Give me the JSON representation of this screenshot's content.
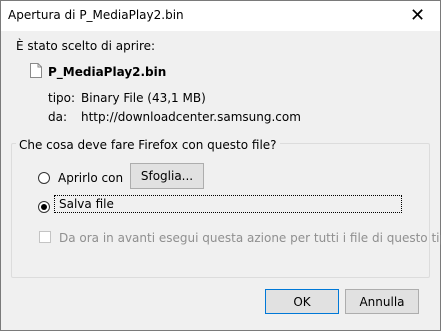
{
  "window": {
    "title": "Apertura di P_MediaPlay2.bin",
    "close_glyph": "✕"
  },
  "file": {
    "intro": "È stato scelto di aprire:",
    "icon": "file-icon",
    "name": "P_MediaPlay2.bin",
    "type_label": "tipo:",
    "type_value": "Binary File (43,1 MB)",
    "from_label": "da:",
    "from_value": "http://downloadcenter.samsung.com"
  },
  "action": {
    "legend": "Che cosa deve fare Firefox con questo file?",
    "open_with_label": "Aprirlo con",
    "browse_label": "Sfoglia...",
    "save_label": "Salva file",
    "selected": "save",
    "remember_label": "Da ora in avanti esegui questa azione per tutti i file di questo tipo.",
    "remember_enabled": false
  },
  "buttons": {
    "ok": "OK",
    "cancel": "Annulla"
  }
}
